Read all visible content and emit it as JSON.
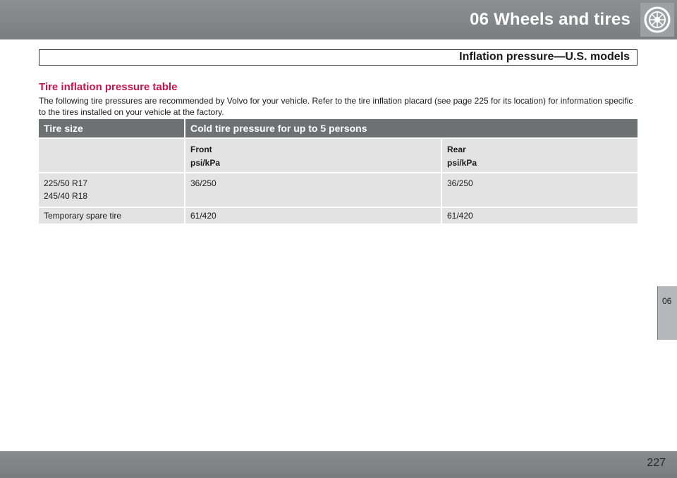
{
  "header": {
    "chapter_title": "06  Wheels and tires",
    "section_title": "Inflation pressure—U.S. models"
  },
  "content": {
    "title": "Tire inflation pressure table",
    "intro": "The following tire pressures are recommended by Volvo for your vehicle. Refer to the tire inflation placard (see page 225 for its location) for information specific to the tires installed on your vehicle at the factory."
  },
  "table": {
    "headers": [
      "Tire size",
      "Cold tire pressure for up to 5 persons"
    ],
    "subheaders": {
      "front": "Front",
      "front_unit": "psi/kPa",
      "rear": "Rear",
      "rear_unit": "psi/kPa"
    },
    "rows": [
      {
        "sizes": [
          "225/50 R17",
          "245/40 R18"
        ],
        "front": "36/250",
        "rear": "36/250"
      },
      {
        "sizes": [
          "Temporary spare tire"
        ],
        "front": "61/420",
        "rear": "61/420"
      }
    ]
  },
  "side_tab": {
    "label": "06"
  },
  "footer": {
    "page_number": "227"
  },
  "icons": {
    "header_icon": "wheel-icon"
  },
  "colors": {
    "header": "#7c7d80",
    "accent": "#c8134e",
    "table_header": "#6f7074",
    "table_cell": "#e3e3e4"
  }
}
